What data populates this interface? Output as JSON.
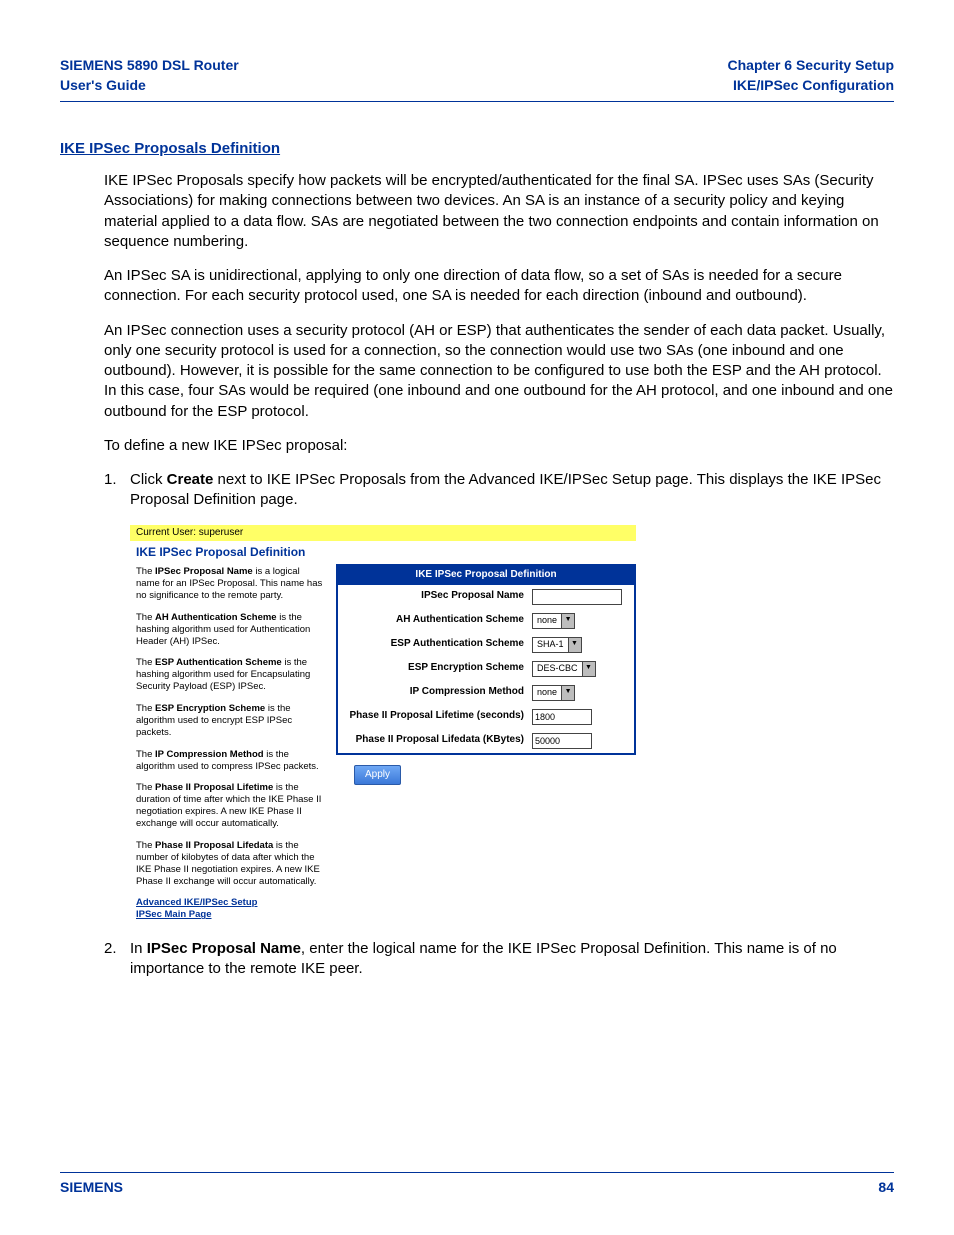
{
  "header": {
    "left_line1": "SIEMENS 5890 DSL Router",
    "left_line2": "User's Guide",
    "right_line1": "Chapter 6  Security Setup",
    "right_line2": "IKE/IPSec Configuration"
  },
  "section_title": "IKE IPSec Proposals Definition",
  "paragraphs": {
    "p1": "IKE IPSec Proposals specify how packets will be encrypted/authenticated for the final SA. IPSec uses SAs (Security Associations) for making connections between two devices. An SA is an instance of a security policy and keying material applied to a data flow. SAs are negotiated between the two connection endpoints and contain information on sequence numbering.",
    "p2": "An IPSec SA is unidirectional, applying to only one direction of data flow, so a set of SAs is needed for a secure connection. For each security protocol used, one SA is needed for each direction (inbound and outbound).",
    "p3": "An IPSec connection uses a security protocol (AH or ESP) that authenticates the sender of each data packet. Usually, only one security protocol is used for a connection, so the connection would use two SAs (one inbound and one outbound). However, it is possible for the same connection to be configured to use both the ESP and the AH protocol. In this case, four SAs would be required (one inbound and one outbound for the AH protocol, and one inbound and one outbound for the ESP protocol.",
    "p4": "To define a new IKE IPSec proposal:"
  },
  "steps": {
    "s1_num": "1.",
    "s1_pre": "Click ",
    "s1_bold": "Create",
    "s1_post": " next to IKE IPSec Proposals from the Advanced IKE/IPSec Setup page. This displays the IKE IPSec Proposal Definition page.",
    "s2_num": "2.",
    "s2_pre": "In ",
    "s2_bold": "IPSec Proposal Name",
    "s2_post": ", enter the logical name for the IKE IPSec Proposal Definition. This name is of no importance to the remote IKE peer."
  },
  "screenshot": {
    "current_user": "Current User: superuser",
    "title": "IKE IPSec Proposal Definition",
    "help": {
      "d1_pre": "The ",
      "d1_b": "IPSec Proposal Name",
      "d1_post": " is a logical name for an IPSec Proposal. This name has no significance to the remote party.",
      "d2_pre": "The ",
      "d2_b": "AH Authentication Scheme",
      "d2_post": " is the hashing algorithm used for Authentication Header (AH) IPSec.",
      "d3_pre": "The ",
      "d3_b": "ESP Authentication Scheme",
      "d3_post": " is the hashing algorithm used for Encapsulating Security Payload (ESP) IPSec.",
      "d4_pre": "The ",
      "d4_b": "ESP Encryption Scheme",
      "d4_post": " is the algorithm used to encrypt ESP IPSec packets.",
      "d5_pre": "The ",
      "d5_b": "IP Compression Method",
      "d5_post": " is the algorithm used to compress IPSec packets.",
      "d6_pre": "The ",
      "d6_b": "Phase II Proposal Lifetime",
      "d6_post": " is the duration of time after which the IKE Phase II negotiation expires. A new IKE Phase II exchange will occur automatically.",
      "d7_pre": "The ",
      "d7_b": "Phase II Proposal Lifedata",
      "d7_post": " is the number of kilobytes of data after which the IKE Phase II negotiation expires. A new IKE Phase II exchange will occur automatically."
    },
    "links": {
      "l1": "Advanced IKE/IPSec Setup",
      "l2": "IPSec Main Page"
    },
    "form": {
      "header": "IKE IPSec Proposal Definition",
      "rows": {
        "r1": {
          "label": "IPSec Proposal Name",
          "value": ""
        },
        "r2": {
          "label": "AH Authentication Scheme",
          "value": "none"
        },
        "r3": {
          "label": "ESP Authentication Scheme",
          "value": "SHA-1"
        },
        "r4": {
          "label": "ESP Encryption Scheme",
          "value": "DES-CBC"
        },
        "r5": {
          "label": "IP Compression Method",
          "value": "none"
        },
        "r6": {
          "label": "Phase II Proposal Lifetime (seconds)",
          "value": "1800"
        },
        "r7": {
          "label": "Phase II Proposal Lifedata (KBytes)",
          "value": "50000"
        }
      },
      "apply": "Apply"
    }
  },
  "footer": {
    "brand": "SIEMENS",
    "page": "84"
  }
}
